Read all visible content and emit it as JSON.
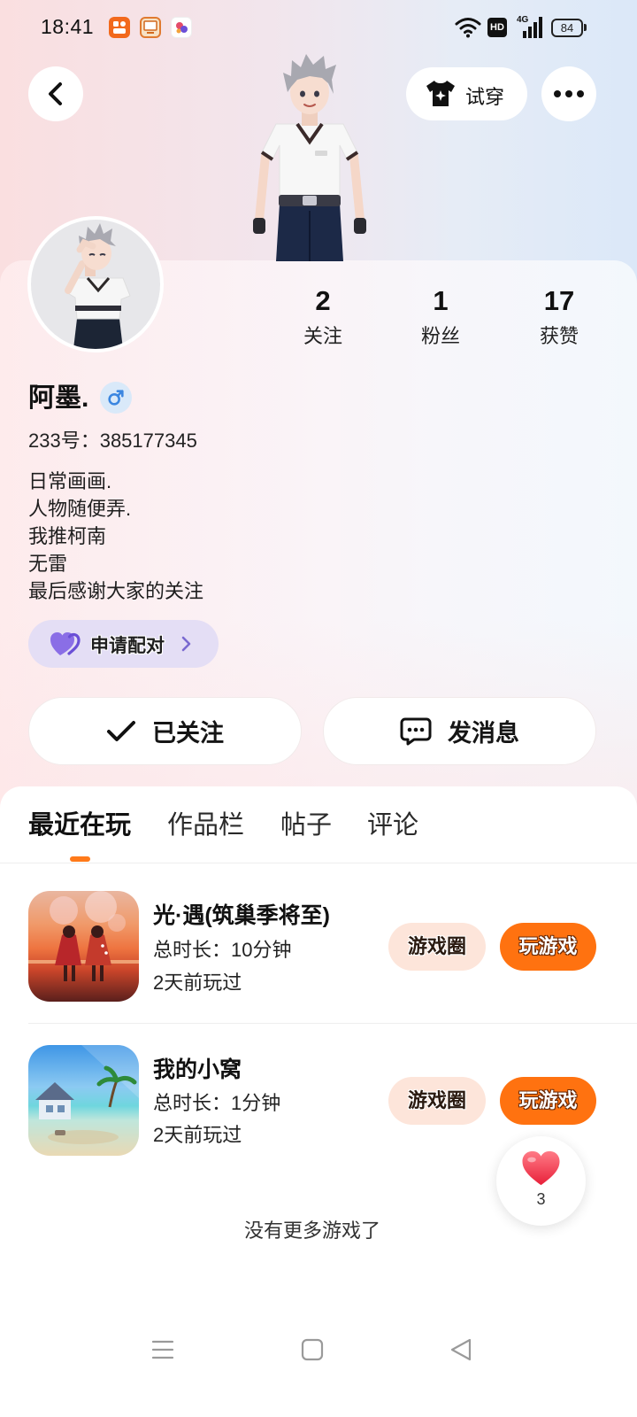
{
  "status_bar": {
    "time": "18:41",
    "hd": "HD",
    "network": "4G",
    "battery": "84",
    "app_icons": [
      "233-app-icon",
      "reader-app-icon",
      "game-app-icon"
    ]
  },
  "header": {
    "try_on_label": "试穿"
  },
  "profile": {
    "stats": [
      {
        "value": "2",
        "label": "关注"
      },
      {
        "value": "1",
        "label": "粉丝"
      },
      {
        "value": "17",
        "label": "获赞"
      }
    ],
    "name": "阿墨.",
    "gender": "male",
    "id_text": "233号：385177345",
    "bio": [
      "日常画画.",
      "人物随便弄.",
      "我推柯南",
      "无雷",
      "最后感谢大家的关注"
    ],
    "pair_label": "申请配对",
    "follow_label": "已关注",
    "message_label": "发消息"
  },
  "tabs": [
    {
      "label": "最近在玩",
      "active": true
    },
    {
      "label": "作品栏",
      "active": false
    },
    {
      "label": "帖子",
      "active": false
    },
    {
      "label": "评论",
      "active": false
    }
  ],
  "games": [
    {
      "name": "光·遇(筑巢季将至)",
      "duration": "总时长：10分钟",
      "last_played": "2天前玩过",
      "circle_label": "游戏圈",
      "play_label": "玩游戏"
    },
    {
      "name": "我的小窝",
      "duration": "总时长：1分钟",
      "last_played": "2天前玩过",
      "circle_label": "游戏圈",
      "play_label": "玩游戏"
    }
  ],
  "like": {
    "count": "3"
  },
  "footer_text": "没有更多游戏了",
  "colors": {
    "accent_orange": "#FF7210",
    "pair_purple": "#7B5BE0",
    "male_blue": "#3B86E0",
    "like_red": "#F0334B"
  }
}
